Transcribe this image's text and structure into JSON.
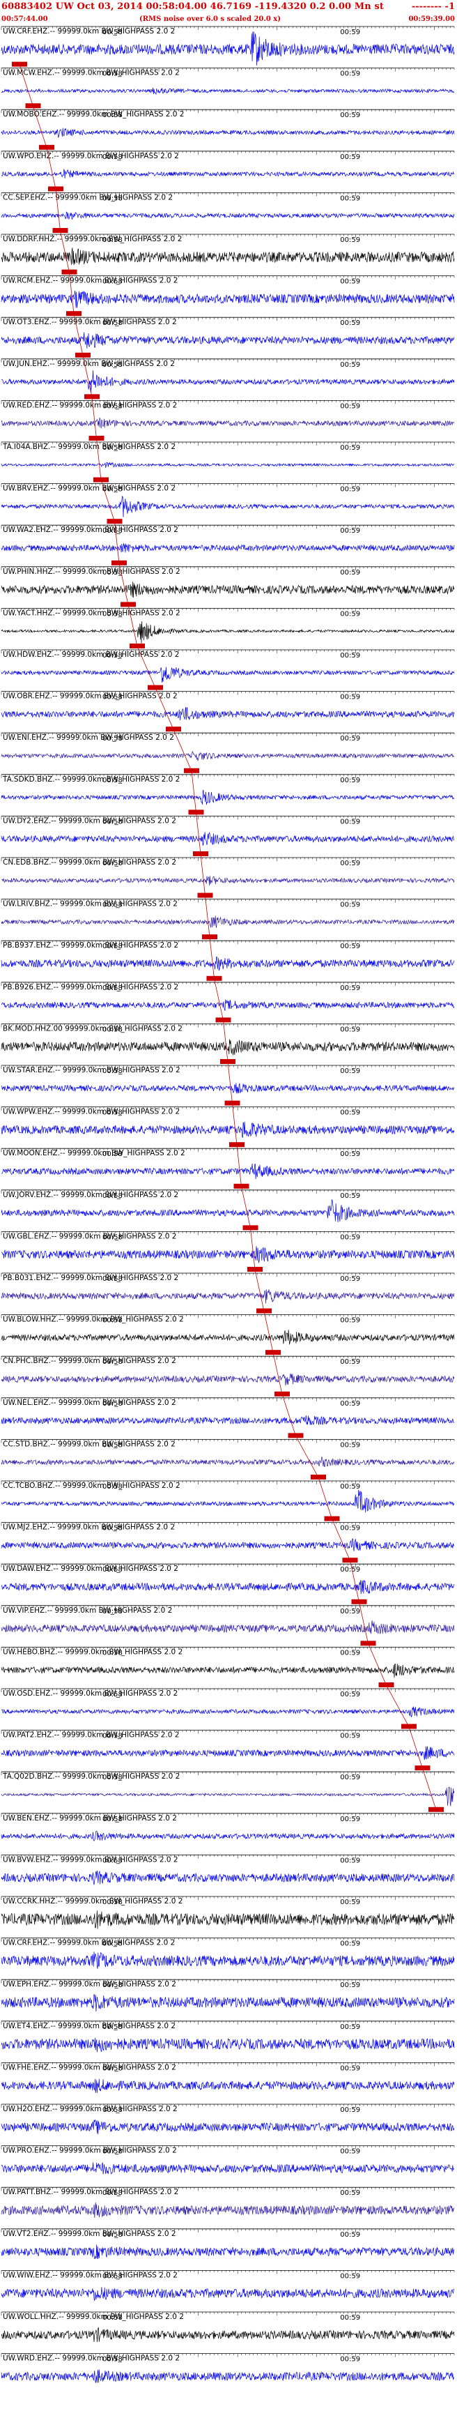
{
  "header": {
    "title": "60883402 UW Oct 03, 2014 00:58:04.00    46.7169  -119.4320  0.2  0.00  Mn st",
    "title_tail": "-------- -1",
    "start_time": "00:57:44.00",
    "note": "(RMS noise over 6.0 s scaled 20.0 x)",
    "end_time": "00:59:39.00"
  },
  "chart_data": {
    "type": "line",
    "title": "60883402 UW Oct 03, 2014 00:58:04.00",
    "time_range": [
      "00:57:44.00",
      "00:59:39.00"
    ],
    "tick_labels": [
      "00:58",
      "00:59"
    ],
    "pick_color": "#cc0000",
    "series": [
      {
        "label": "UW.CRF.EHZ.-- 99999.0km BW_HIGHPASS 2.0 2",
        "color": "#0000ee",
        "amp": 0.95,
        "noise": 0.25,
        "burst": 0.55,
        "pick": 0.04
      },
      {
        "label": "UW.MCW.EHZ.-- 99999.0km BW_HIGHPASS 2.0 2",
        "color": "#0000ee",
        "amp": 0.15,
        "noise": 0.08,
        "burst": 0.33,
        "pick": 0.07
      },
      {
        "label": "UW.MOBO.EHZ.-- 99999.0km BW_HIGHPASS 2.0 2",
        "color": "#0000ee",
        "amp": 0.22,
        "noise": 0.1,
        "burst": 0.12,
        "pick": 0.1
      },
      {
        "label": "UW.WPO.EHZ.-- 99999.0km BW_HIGHPASS 2.0 2",
        "color": "#0000ee",
        "amp": 0.18,
        "noise": 0.1,
        "burst": 0.13,
        "pick": 0.12
      },
      {
        "label": "CC.SEP.EHZ.-- 99999.0km BW_HIGHPASS 2.0 2",
        "color": "#0000ee",
        "amp": 0.15,
        "noise": 0.1,
        "burst": 0.14,
        "pick": 0.13
      },
      {
        "label": "UW.DDRF.HHZ.-- 99999.0km BW_HIGHPASS 2.0 2",
        "color": "#000000",
        "amp": 0.3,
        "noise": 0.25,
        "burst": 0.15,
        "pick": 0.15
      },
      {
        "label": "UW.RCM.EHZ.-- 99999.0km BW_HIGHPASS 2.0 2",
        "color": "#0000ee",
        "amp": 0.35,
        "noise": 0.22,
        "burst": 0.16,
        "pick": 0.16
      },
      {
        "label": "UW.OT3.EHZ.-- 99999.0km BW_HIGHPASS 2.0 2",
        "color": "#0000ee",
        "amp": 0.45,
        "noise": 0.18,
        "burst": 0.18,
        "pick": 0.18
      },
      {
        "label": "UW.JUN.EHZ.-- 99999.0km BW_HIGHPASS 2.0 2",
        "color": "#0000ee",
        "amp": 0.7,
        "noise": 0.12,
        "burst": 0.19,
        "pick": 0.2
      },
      {
        "label": "UW.RED.EHZ.-- 99999.0km BW_HIGHPASS 2.0 2",
        "color": "#2a1aaa",
        "amp": 0.2,
        "noise": 0.12,
        "burst": 0.21,
        "pick": 0.21
      },
      {
        "label": "TA.I04A.BHZ.-- 99999.0km BW_HIGHPASS 2.0 2",
        "color": "#0000ee",
        "amp": 0.12,
        "noise": 0.06,
        "burst": 0.22,
        "pick": 0.22
      },
      {
        "label": "UW.BRV.EHZ.-- 99999.0km BW_HIGHPASS 2.0 2",
        "color": "#0000ee",
        "amp": 0.65,
        "noise": 0.1,
        "burst": 0.26,
        "pick": 0.25
      },
      {
        "label": "UW.WA2.EHZ.-- 99999.0km BW_HIGHPASS 2.0 2",
        "color": "#0000ee",
        "amp": 0.2,
        "noise": 0.14,
        "burst": 0.26,
        "pick": 0.26
      },
      {
        "label": "UW.PHIN.HHZ.-- 99999.0km BW_HIGHPASS 2.0 2",
        "color": "#000000",
        "amp": 0.3,
        "noise": 0.2,
        "burst": 0.28,
        "pick": 0.28
      },
      {
        "label": "UW.YACT.HHZ.-- 99999.0km BW_HIGHPASS 2.0 2",
        "color": "#000000",
        "amp": 0.8,
        "noise": 0.06,
        "burst": 0.3,
        "pick": 0.3
      },
      {
        "label": "UW.HDW.EHZ.-- 99999.0km BW_HIGHPASS 2.0 2",
        "color": "#0000ee",
        "amp": 0.65,
        "noise": 0.1,
        "burst": 0.35,
        "pick": 0.34
      },
      {
        "label": "UW.OBR.EHZ.-- 99999.0km BW_HIGHPASS 2.0 2",
        "color": "#0000ee",
        "amp": 0.4,
        "noise": 0.15,
        "burst": 0.39,
        "pick": 0.38
      },
      {
        "label": "UW.ENI.EHZ.-- 99999.0km BW_HIGHPASS 2.0 2",
        "color": "#2a1aaa",
        "amp": 0.25,
        "noise": 0.1,
        "burst": 0.42,
        "pick": 0.42
      },
      {
        "label": "TA.SDKD.BHZ.-- 99999.0km BW_HIGHPASS 2.0 2",
        "color": "#0000ee",
        "amp": 0.45,
        "noise": 0.1,
        "burst": 0.44,
        "pick": 0.43
      },
      {
        "label": "UW.DY2.EHZ.-- 99999.0km BW_HIGHPASS 2.0 2",
        "color": "#0000ee",
        "amp": 0.35,
        "noise": 0.15,
        "burst": 0.44,
        "pick": 0.44
      },
      {
        "label": "CN.EDB.BHZ.-- 99999.0km BW_HIGHPASS 2.0 2",
        "color": "#2a1aaa",
        "amp": 0.2,
        "noise": 0.1,
        "burst": 0.45,
        "pick": 0.45
      },
      {
        "label": "UW.LRIV.BHZ.-- 99999.0km BW_HIGHPASS 2.0 2",
        "color": "#2a1aaa",
        "amp": 0.35,
        "noise": 0.1,
        "burst": 0.46,
        "pick": 0.46
      },
      {
        "label": "PB.B937.EHZ.-- 99999.0km BW_HIGHPASS 2.0 2",
        "color": "#0000ee",
        "amp": 0.25,
        "noise": 0.18,
        "burst": 0.47,
        "pick": 0.47
      },
      {
        "label": "PB.B926.EHZ.-- 99999.0km BW_HIGHPASS 2.0 2",
        "color": "#0000ee",
        "amp": 0.2,
        "noise": 0.14,
        "burst": 0.49,
        "pick": 0.49
      },
      {
        "label": "BK.MOD.HHZ.00 99999.0km BW_HIGHPASS 2.0 2",
        "color": "#000000",
        "amp": 0.3,
        "noise": 0.22,
        "burst": 0.5,
        "pick": 0.5
      },
      {
        "label": "UW.STAR.EHZ.-- 99999.0km BW_HIGHPASS 2.0 2",
        "color": "#0000ee",
        "amp": 0.2,
        "noise": 0.14,
        "burst": 0.51,
        "pick": 0.51
      },
      {
        "label": "UW.WPW.EHZ.-- 99999.0km BW_HIGHPASS 2.0 2",
        "color": "#0000ee",
        "amp": 0.45,
        "noise": 0.2,
        "burst": 0.53,
        "pick": 0.52
      },
      {
        "label": "UW.MOON.EHZ.-- 99999.0km BW_HIGHPASS 2.0 2",
        "color": "#0000ee",
        "amp": 0.4,
        "noise": 0.15,
        "burst": 0.55,
        "pick": 0.53
      },
      {
        "label": "UW.JORV.EHZ.-- 99999.0km BW_HIGHPASS 2.0 2",
        "color": "#0000ee",
        "amp": 0.8,
        "noise": 0.15,
        "burst": 0.72,
        "pick": 0.55
      },
      {
        "label": "UW.GBL.EHZ.-- 99999.0km BW_HIGHPASS 2.0 2",
        "color": "#0000ee",
        "amp": 0.4,
        "noise": 0.2,
        "burst": 0.56,
        "pick": 0.56
      },
      {
        "label": "PB.B031.EHZ.-- 99999.0km BW_HIGHPASS 2.0 2",
        "color": "#2a1aaa",
        "amp": 0.35,
        "noise": 0.15,
        "burst": 0.58,
        "pick": 0.58
      },
      {
        "label": "UW.BLOW.HHZ.-- 99999.0km BW_HIGHPASS 2.0 2",
        "color": "#000000",
        "amp": 0.4,
        "noise": 0.15,
        "burst": 0.62,
        "pick": 0.6
      },
      {
        "label": "CN.PHC.BHZ.-- 99999.0km BW_HIGHPASS 2.0 2",
        "color": "#2a1aaa",
        "amp": 0.25,
        "noise": 0.15,
        "burst": 0.62,
        "pick": 0.62
      },
      {
        "label": "UW.NEL.EHZ.-- 99999.0km BW_HIGHPASS 2.0 2",
        "color": "#0000ee",
        "amp": 0.25,
        "noise": 0.15,
        "burst": 0.66,
        "pick": 0.65
      },
      {
        "label": "CC.STD.BHZ.-- 99999.0km BW_HIGHPASS 2.0 2",
        "color": "#2a1aaa",
        "amp": 0.2,
        "noise": 0.12,
        "burst": 0.7,
        "pick": 0.7
      },
      {
        "label": "CC.TCBO.BHZ.-- 99999.0km BW_HIGHPASS 2.0 2",
        "color": "#0000ee",
        "amp": 0.85,
        "noise": 0.1,
        "burst": 0.78,
        "pick": 0.73
      },
      {
        "label": "UW.MJ2.EHZ.-- 99999.0km BW_HIGHPASS 2.0 2",
        "color": "#0000ee",
        "amp": 0.25,
        "noise": 0.15,
        "burst": 0.77,
        "pick": 0.77
      },
      {
        "label": "UW.DAW.EHZ.-- 99999.0km BW_HIGHPASS 2.0 2",
        "color": "#0000ee",
        "amp": 0.3,
        "noise": 0.18,
        "burst": 0.79,
        "pick": 0.79
      },
      {
        "label": "UW.VIP.EHZ.-- 99999.0km BW_HIGHPASS 2.0 2",
        "color": "#2a1aaa",
        "amp": 0.3,
        "noise": 0.18,
        "burst": 0.81,
        "pick": 0.81
      },
      {
        "label": "UW.HEBO.BHZ.-- 99999.0km BW_HIGHPASS 2.0 2",
        "color": "#000000",
        "amp": 0.35,
        "noise": 0.15,
        "burst": 0.86,
        "pick": 0.85
      },
      {
        "label": "UW.OSD.EHZ.-- 99999.0km BW_HIGHPASS 2.0 2",
        "color": "#0000ee",
        "amp": 0.25,
        "noise": 0.1,
        "burst": 0.9,
        "pick": 0.9
      },
      {
        "label": "UW.PAT2.EHZ.-- 99999.0km BW_HIGHPASS 2.0 2",
        "color": "#0000ee",
        "amp": 0.3,
        "noise": 0.15,
        "burst": 0.93,
        "pick": 0.93
      },
      {
        "label": "TA.Q02D.BHZ.-- 99999.0km BW_HIGHPASS 2.0 2",
        "color": "#2a1aaa",
        "amp": 0.85,
        "noise": 0.06,
        "burst": 0.98,
        "pick": 0.96
      },
      {
        "label": "UW.BEN.EHZ.-- 99999.0km BW_HIGHPASS 2.0 2",
        "color": "#0000ee",
        "amp": 0.2,
        "noise": 0.12,
        "burst": 0.2,
        "pick": -1
      },
      {
        "label": "UW.BVW.EHZ.-- 99999.0km BW_HIGHPASS 2.0 2",
        "color": "#0000ee",
        "amp": 0.25,
        "noise": 0.2,
        "burst": 0.2,
        "pick": -1
      },
      {
        "label": "UW.CCRK.HHZ.-- 99999.0km BW_HIGHPASS 2.0 2",
        "color": "#000000",
        "amp": 0.3,
        "noise": 0.28,
        "burst": 0.2,
        "pick": -1
      },
      {
        "label": "UW.CRF.EHZ.-- 99999.0km BW_HIGHPASS 2.0 2",
        "color": "#0000ee",
        "amp": 0.3,
        "noise": 0.25,
        "burst": 0.2,
        "pick": -1
      },
      {
        "label": "UW.EPH.EHZ.-- 99999.0km BW_HIGHPASS 2.0 2",
        "color": "#0000ee",
        "amp": 0.3,
        "noise": 0.25,
        "burst": 0.2,
        "pick": -1
      },
      {
        "label": "UW.ET4.EHZ.-- 99999.0km BW_HIGHPASS 2.0 2",
        "color": "#0000ee",
        "amp": 0.3,
        "noise": 0.25,
        "burst": 0.2,
        "pick": -1
      },
      {
        "label": "UW.FHE.EHZ.-- 99999.0km BW_HIGHPASS 2.0 2",
        "color": "#0000ee",
        "amp": 0.25,
        "noise": 0.2,
        "burst": 0.2,
        "pick": -1
      },
      {
        "label": "UW.H2O.EHZ.-- 99999.0km BW_HIGHPASS 2.0 2",
        "color": "#0000ee",
        "amp": 0.25,
        "noise": 0.2,
        "burst": 0.2,
        "pick": -1
      },
      {
        "label": "UW.PRO.EHZ.-- 99999.0km BW_HIGHPASS 2.0 2",
        "color": "#0000ee",
        "amp": 0.25,
        "noise": 0.2,
        "burst": 0.2,
        "pick": -1
      },
      {
        "label": "UW.PATT.BHZ.-- 99999.0km BW_HIGHPASS 2.0 2",
        "color": "#2a1aaa",
        "amp": 0.25,
        "noise": 0.22,
        "burst": 0.2,
        "pick": -1
      },
      {
        "label": "UW.VT2.EHZ.-- 99999.0km BW_HIGHPASS 2.0 2",
        "color": "#0000ee",
        "amp": 0.25,
        "noise": 0.2,
        "burst": 0.2,
        "pick": -1
      },
      {
        "label": "UW.WIW.EHZ.-- 99999.0km BW_HIGHPASS 2.0 2",
        "color": "#0000ee",
        "amp": 0.25,
        "noise": 0.22,
        "burst": 0.2,
        "pick": -1
      },
      {
        "label": "UW.WOLL.HHZ.-- 99999.0km BW_HIGHPASS 2.0 2",
        "color": "#000000",
        "amp": 0.25,
        "noise": 0.2,
        "burst": 0.2,
        "pick": -1
      },
      {
        "label": "UW.WRD.EHZ.-- 99999.0km BW_HIGHPASS 2.0 2",
        "color": "#0000ee",
        "amp": 0.25,
        "noise": 0.2,
        "burst": 0.2,
        "pick": -1
      }
    ]
  }
}
